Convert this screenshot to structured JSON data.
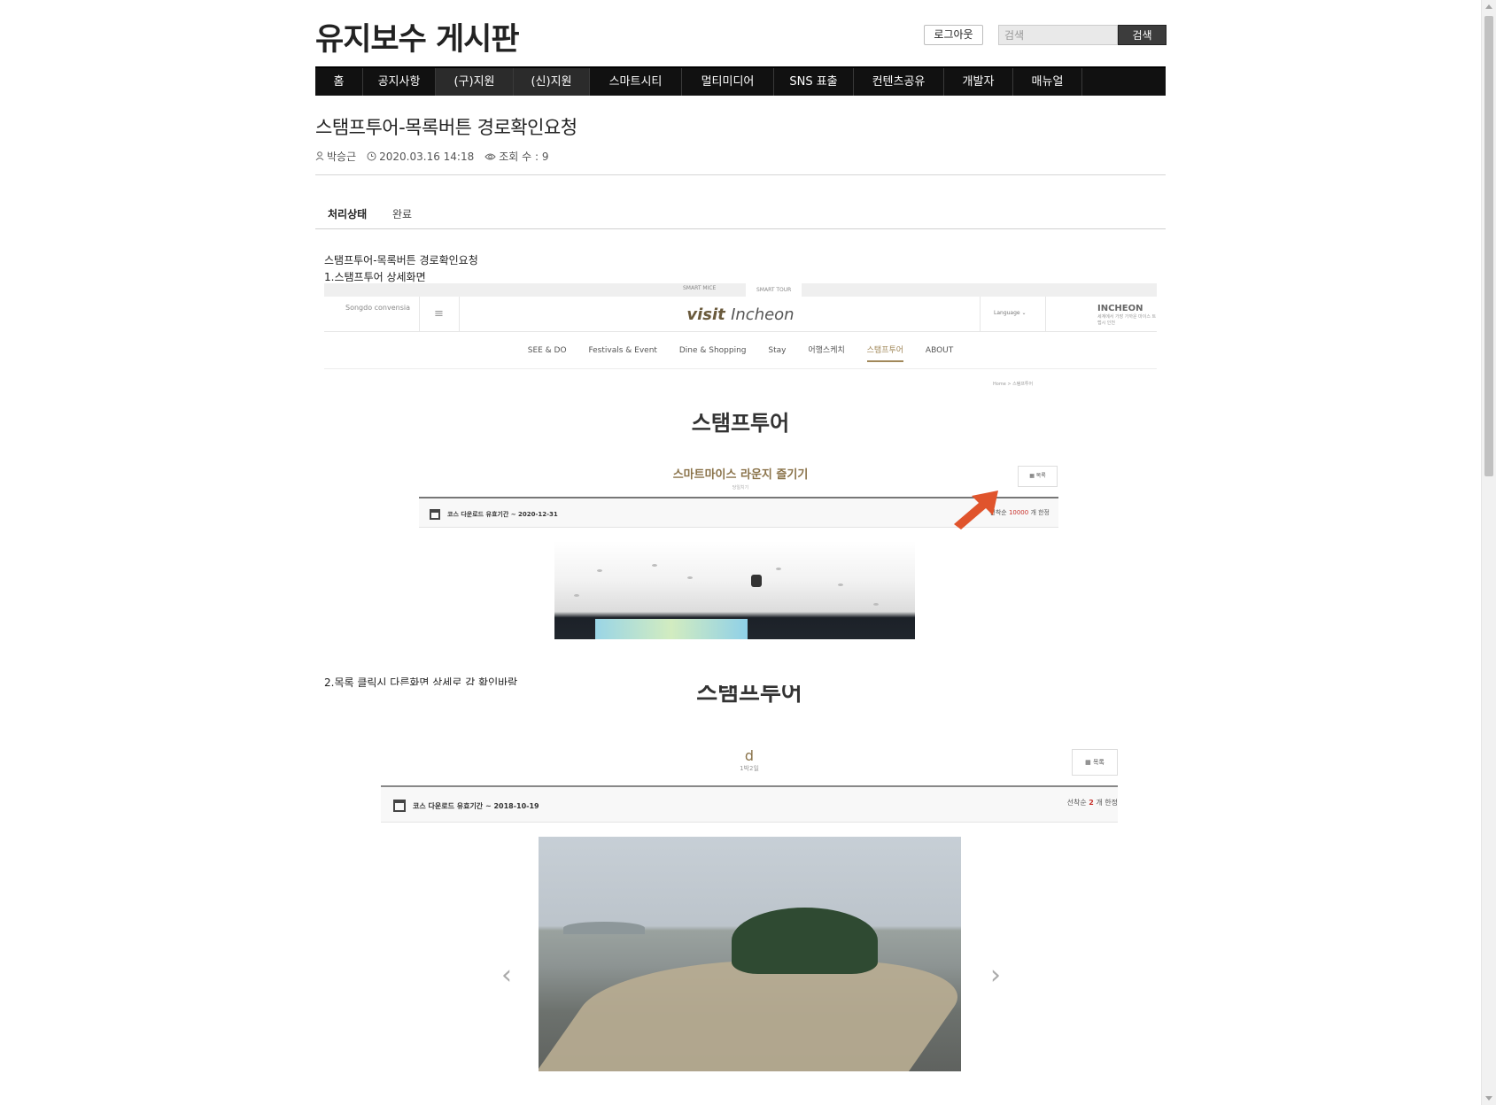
{
  "site": {
    "title": "유지보수 게시판"
  },
  "header": {
    "logout_label": "로그아웃",
    "search_placeholder": "검색",
    "search_button": "검색"
  },
  "nav": {
    "items": [
      "홈",
      "공지사항",
      "(구)지원",
      "(신)지원",
      "스마트시티",
      "멀티미디어",
      "SNS 표출",
      "컨텐츠공유",
      "개발자",
      "매뉴얼"
    ]
  },
  "post": {
    "title": "스탬프투어-목록버튼 경로확인요청",
    "author": "박승근",
    "datetime": "2020.03.16 14:18",
    "views": "조회 수 : 9",
    "status_label": "처리상태",
    "status_value": "완료",
    "line1": "스탬프투어-목록버튼 경로확인요청",
    "line2": "1.스탬프투어 상세화면",
    "line3": "2.목록 클릭시 다른화면 상세로 감 확인바람"
  },
  "shot1": {
    "tab_left": "SMART MICE",
    "tab_right": "SMART TOUR",
    "logo_left": "Songdo convensia",
    "brand_a": "visit",
    "brand_b": "Incheon",
    "language": "Language ⌄",
    "incheon": "INCHEON",
    "incheon_sub": "세계에서 가장 가까운 마이스 트랩시 인천",
    "menu": [
      "SEE & DO",
      "Festivals & Event",
      "Dine & Shopping",
      "Stay",
      "어행스케치",
      "스탬프투어",
      "ABOUT"
    ],
    "active_menu": "스탬프투어",
    "crumb": "Home  >  스탬프투어",
    "heading": "스탬프투어",
    "subheading": "스마트마이스 라운지 즐기기",
    "subheading_small": "당일치기",
    "list_button": "목록",
    "period": "코스 다운로드 유효기간 ~ 2020-12-31",
    "limit_prefix": "선착순 ",
    "limit_value": "10000",
    "limit_suffix": " 개 한정"
  },
  "shot2": {
    "heading": "스탬프투어",
    "title": "d",
    "duration": "1박2일",
    "list_button": "목록",
    "period": "코스 다운로드 유효기간 ~ 2018-10-19",
    "limit_prefix": "선착순 ",
    "limit_value": "2",
    "limit_suffix": " 개 한정",
    "prev": "‹",
    "next": "›"
  },
  "colors": {
    "nav_bg": "#111111",
    "accent_gold": "#a1885a",
    "arrow": "#e0542c",
    "limit_red": "#c8312b"
  }
}
